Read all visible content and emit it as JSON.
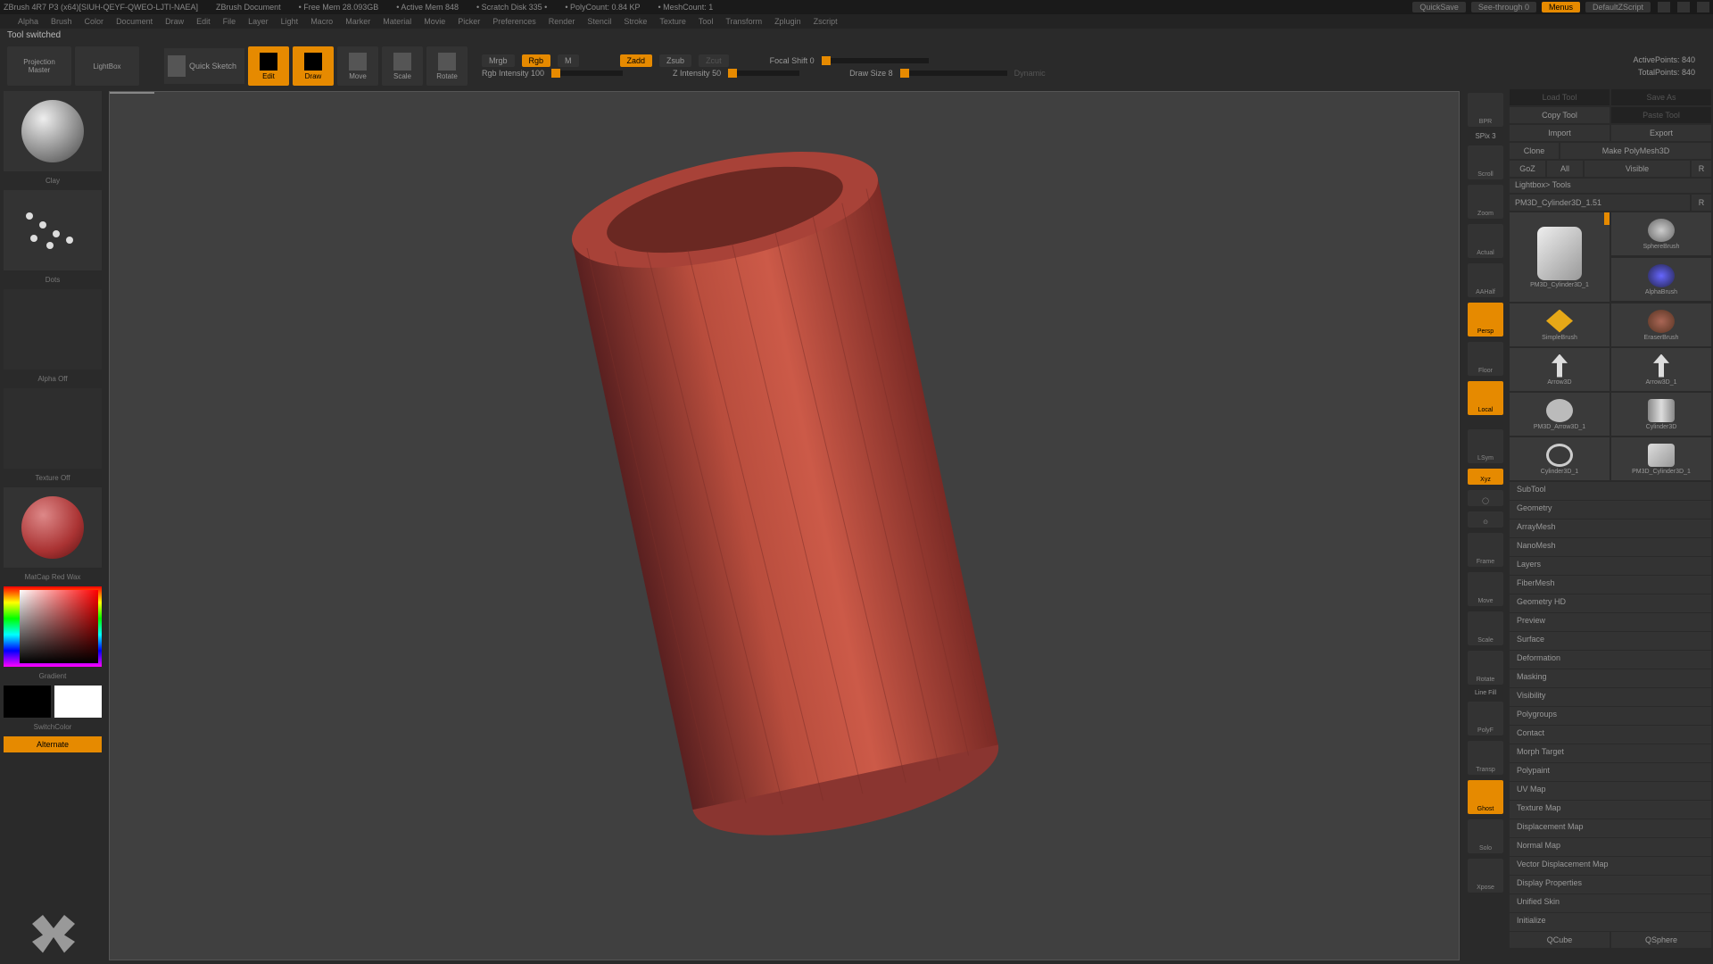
{
  "titlebar": {
    "app": "ZBrush 4R7 P3 (x64)[SIUH-QEYF-QWEO-LJTI-NAEA]",
    "doc": "ZBrush Document",
    "freemem": "• Free Mem 28.093GB",
    "activemem": "• Active Mem 848",
    "scratch": "• Scratch Disk 335 •",
    "polycount": "• PolyCount: 0.84 KP",
    "meshcount": "• MeshCount: 1",
    "quicksave": "QuickSave",
    "seethrough": "See-through  0",
    "menus": "Menus",
    "defaultscript": "DefaultZScript"
  },
  "menu": [
    "Alpha",
    "Brush",
    "Color",
    "Document",
    "Draw",
    "Edit",
    "File",
    "Layer",
    "Light",
    "Macro",
    "Marker",
    "Material",
    "Movie",
    "Picker",
    "Preferences",
    "Render",
    "Stencil",
    "Stroke",
    "Texture",
    "Tool",
    "Transform",
    "Zplugin",
    "Zscript"
  ],
  "status": "Tool switched",
  "toolbar": {
    "projection": "Projection\nMaster",
    "lightbox": "LightBox",
    "quicksketch": "Quick Sketch",
    "edit": "Edit",
    "draw": "Draw",
    "move": "Move",
    "scale": "Scale",
    "rotate": "Rotate",
    "mrgb": "Mrgb",
    "rgb": "Rgb",
    "m": "M",
    "rgb_intensity": "Rgb Intensity 100",
    "zadd": "Zadd",
    "zsub": "Zsub",
    "zcut": "Zcut",
    "z_intensity": "Z Intensity 50",
    "focal": "Focal Shift 0",
    "drawsize": "Draw Size 8",
    "dynamic": "Dynamic",
    "active_pts": "ActivePoints: 840",
    "total_pts": "TotalPoints: 840"
  },
  "left": {
    "brush": "Clay",
    "stroke": "Dots",
    "alpha": "Alpha Off",
    "texture": "Texture Off",
    "material": "MatCap Red Wax",
    "gradient": "Gradient",
    "switchcolor": "SwitchColor",
    "alternate": "Alternate"
  },
  "rail": {
    "bpr": "BPR",
    "spix": "SPix 3",
    "scroll": "Scroll",
    "zoom": "Zoom",
    "actual": "Actual",
    "aahalf": "AAHalf",
    "persp": "Persp",
    "floor": "Floor",
    "local": "Local",
    "lsym": "LSym",
    "xyz": "Xyz",
    "frame": "Frame",
    "move": "Move",
    "scale": "Scale",
    "rotate": "Rotate",
    "linefill": "Line Fill",
    "polyf": "PolyF",
    "transp": "Transp",
    "ghost": "Ghost",
    "solo": "Solo",
    "xpose": "Xpose"
  },
  "right": {
    "loadtool": "Load Tool",
    "saveas": "Save As",
    "copytool": "Copy Tool",
    "pastetool": "Paste Tool",
    "import": "Import",
    "export": "Export",
    "clone": "Clone",
    "makepoly": "Make PolyMesh3D",
    "goz": "GoZ",
    "all": "All",
    "visible": "Visible",
    "r": "R",
    "lightbox_tools": "Lightbox> Tools",
    "toolname": "PM3D_Cylinder3D_1.51",
    "tools": [
      {
        "name": "PM3D_Cylinder3D_1"
      },
      {
        "name": "SphereBrush"
      },
      {
        "name": "AlphaBrush"
      },
      {
        "name": "SimpleBrush"
      },
      {
        "name": "EraserBrush"
      },
      {
        "name": "Arrow3D"
      },
      {
        "name": "Arrow3D_1"
      },
      {
        "name": "PM3D_Arrow3D_1"
      },
      {
        "name": "Cylinder3D"
      },
      {
        "name": "Cylinder3D_1"
      },
      {
        "name": "PM3D_Cylinder3D_1"
      }
    ],
    "sections": [
      "SubTool",
      "Geometry",
      "ArrayMesh",
      "NanoMesh",
      "Layers",
      "FiberMesh",
      "Geometry HD",
      "Preview",
      "Surface",
      "Deformation",
      "Masking",
      "Visibility",
      "Polygroups",
      "Contact",
      "Morph Target",
      "Polypaint",
      "UV Map",
      "Texture Map",
      "Displacement Map",
      "Normal Map",
      "Vector Displacement Map",
      "Display Properties",
      "Unified Skin",
      "Initialize"
    ],
    "qcube": "QCube",
    "qsphere": "QSphere"
  }
}
